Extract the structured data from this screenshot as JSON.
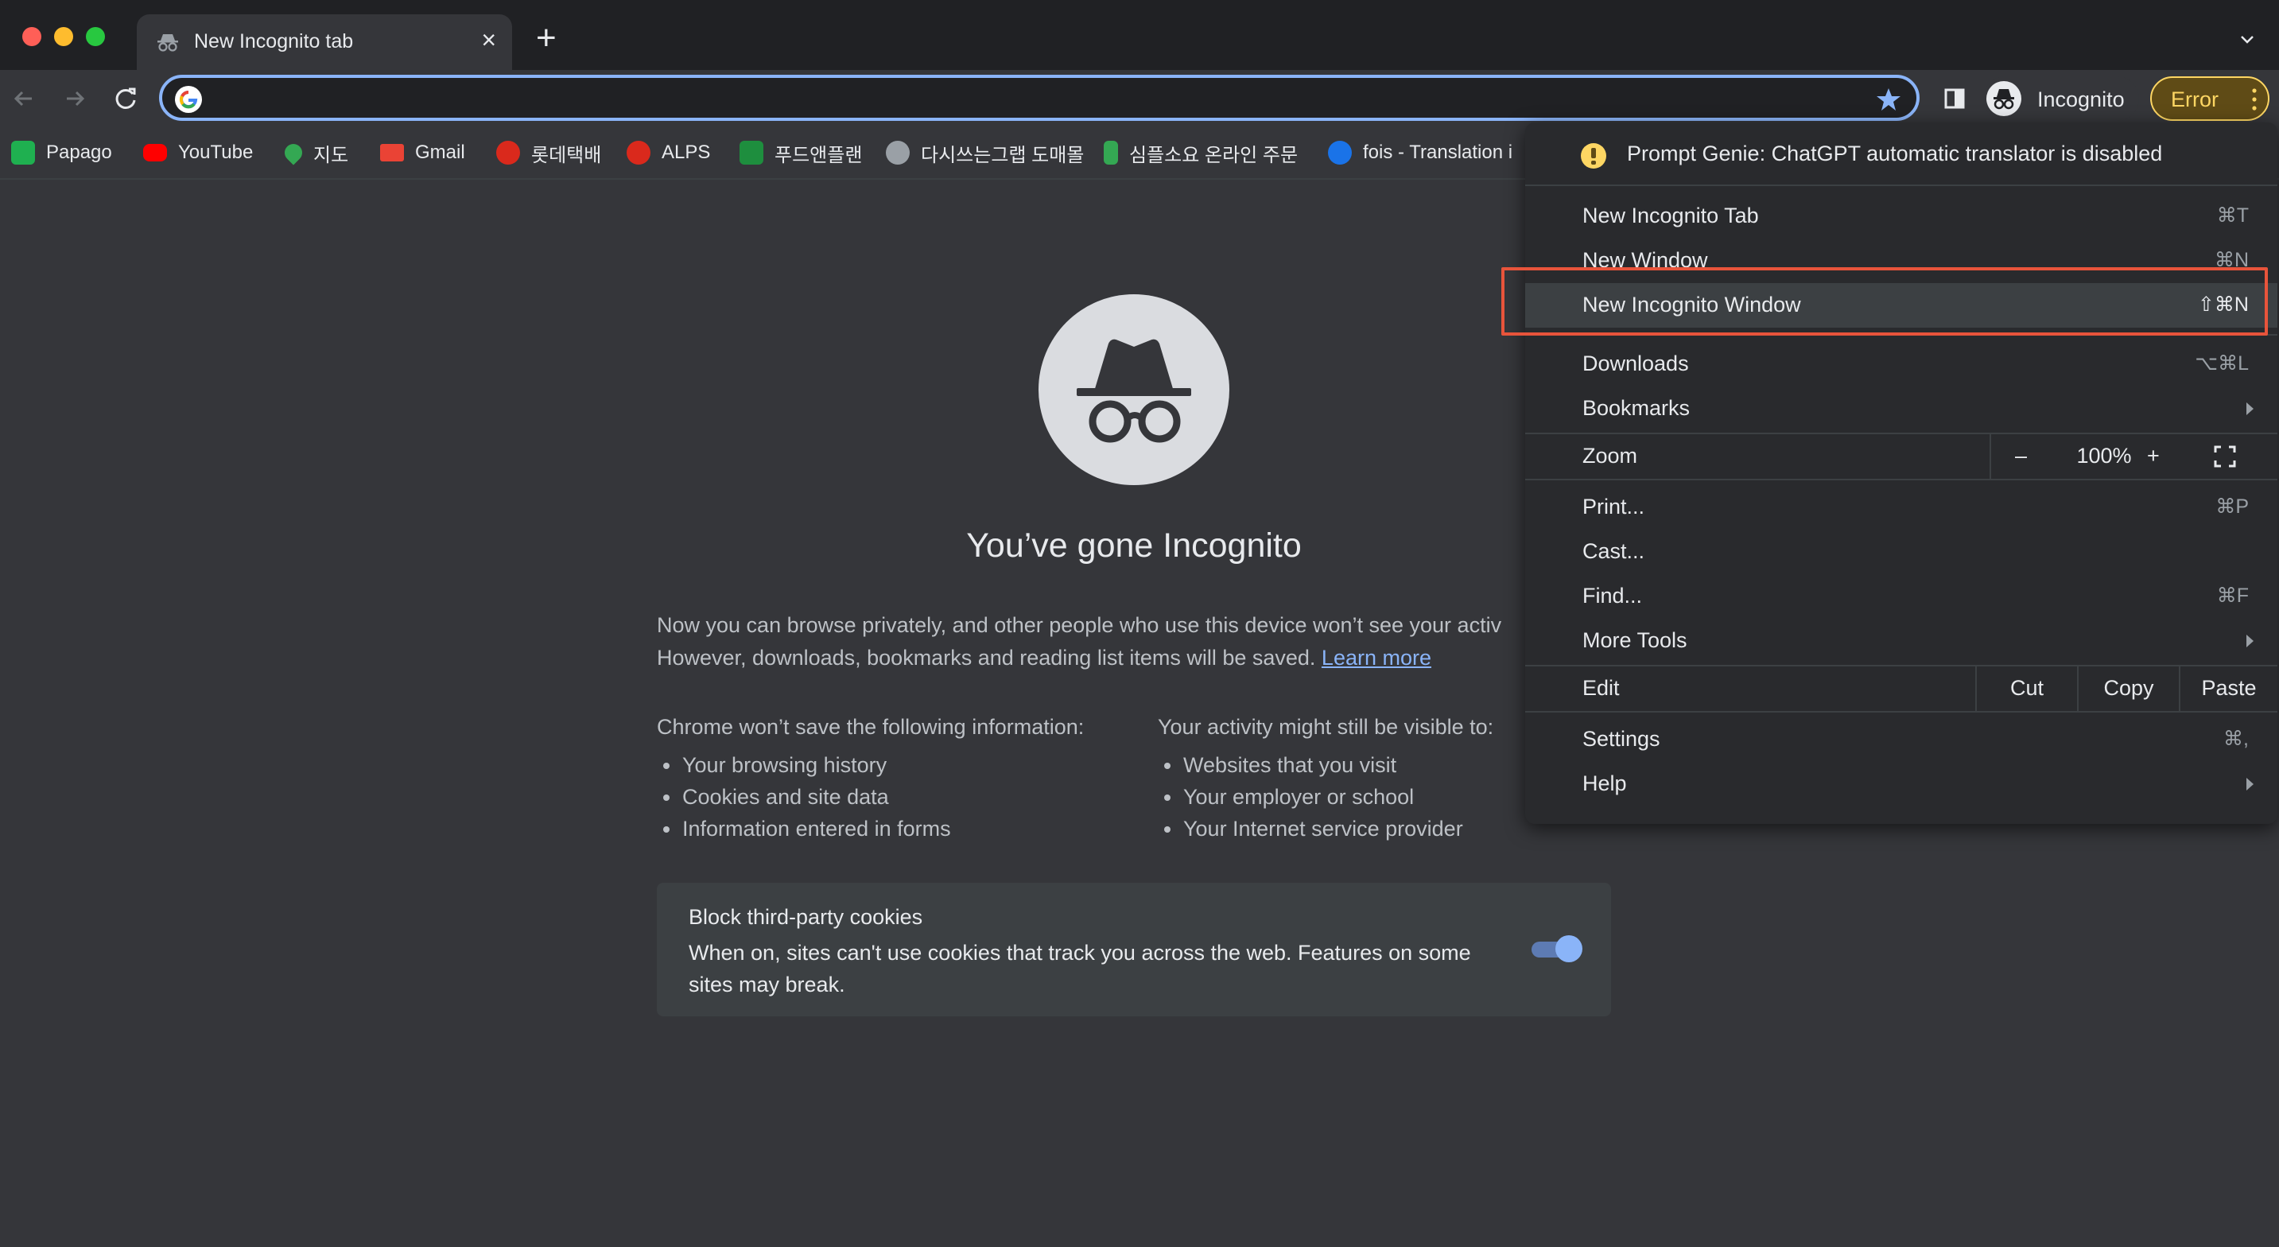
{
  "window": {
    "tab_title": "New Incognito tab",
    "new_tab_symbol": "+",
    "close_symbol": "×"
  },
  "toolbar": {
    "address_value": "",
    "profile_label": "Incognito",
    "error_label": "Error"
  },
  "bookmarks": [
    {
      "label": "Papago",
      "icon": "papago-icon",
      "color": "#1fb050"
    },
    {
      "label": "YouTube",
      "icon": "youtube-icon",
      "color": "#ff0000"
    },
    {
      "label": "지도",
      "icon": "maps-pin-icon",
      "color": "#34a853"
    },
    {
      "label": "Gmail",
      "icon": "gmail-icon",
      "color": "#ea4335"
    },
    {
      "label": "롯데택배",
      "icon": "lotte-icon",
      "color": "#da291c"
    },
    {
      "label": "ALPS",
      "icon": "alps-icon",
      "color": "#da291c"
    },
    {
      "label": "푸드앤플랜",
      "icon": "foodnplan-icon",
      "color": "#1e8e3e"
    },
    {
      "label": "다시쓰는그랩 도매몰",
      "icon": "globe-icon",
      "color": "#9aa0a6"
    },
    {
      "label": "심플소요 온라인 주문",
      "icon": "simple-icon",
      "color": "#34a853"
    },
    {
      "label": "fois - Translation i",
      "icon": "fois-icon",
      "color": "#1a73e8"
    }
  ],
  "ntp": {
    "headline": "You’ve gone Incognito",
    "intro_line1": "Now you can browse privately, and other people who use this device won’t see your activ",
    "intro_line2": "However, downloads, bookmarks and reading list items will be saved.",
    "learn_more": "Learn more",
    "left_title": "Chrome won’t save the following information:",
    "left_items": [
      "Your browsing history",
      "Cookies and site data",
      "Information entered in forms"
    ],
    "right_title": "Your activity might still be visible to:",
    "right_items": [
      "Websites that you visit",
      "Your employer or school",
      "Your Internet service provider"
    ],
    "cookie_title": "Block third-party cookies",
    "cookie_desc": "When on, sites can't use cookies that track you across the web. Features on some sites may break.",
    "cookie_toggle_on": true
  },
  "menu": {
    "warning": "Prompt Genie: ChatGPT automatic translator is disabled",
    "new_incognito_tab": {
      "label": "New Incognito Tab",
      "shortcut": "⌘T"
    },
    "new_window": {
      "label": "New Window",
      "shortcut": "⌘N"
    },
    "new_incognito_window": {
      "label": "New Incognito Window",
      "shortcut": "⇧⌘N"
    },
    "downloads": {
      "label": "Downloads",
      "shortcut": "⌥⌘L"
    },
    "bookmarks": {
      "label": "Bookmarks"
    },
    "zoom": {
      "label": "Zoom",
      "minus": "–",
      "value": "100%",
      "plus": "+"
    },
    "print": {
      "label": "Print...",
      "shortcut": "⌘P"
    },
    "cast": {
      "label": "Cast..."
    },
    "find": {
      "label": "Find...",
      "shortcut": "⌘F"
    },
    "more_tools": {
      "label": "More Tools"
    },
    "edit": {
      "label": "Edit",
      "cut": "Cut",
      "copy": "Copy",
      "paste": "Paste"
    },
    "settings": {
      "label": "Settings",
      "shortcut": "⌘,"
    },
    "help": {
      "label": "Help"
    }
  },
  "colors": {
    "accent": "#8ab4f8",
    "highlight_outline": "#e8543b",
    "warning": "#fdd663"
  }
}
